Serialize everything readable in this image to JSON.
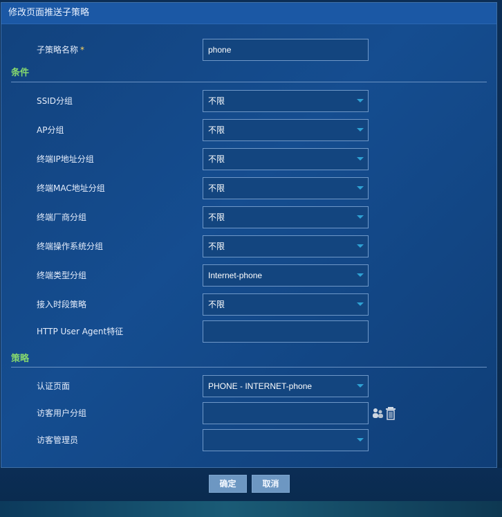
{
  "dialog": {
    "title": "修改页面推送子策略",
    "name_label": "子策略名称",
    "required_mark": "*",
    "name_value": "phone",
    "conditions_title": "条件",
    "policy_title": "策略"
  },
  "conditions": [
    {
      "label": "SSID分组",
      "value": "不限"
    },
    {
      "label": "AP分组",
      "value": "不限"
    },
    {
      "label": "终端IP地址分组",
      "value": "不限"
    },
    {
      "label": "终端MAC地址分组",
      "value": "不限"
    },
    {
      "label": "终端厂商分组",
      "value": "不限"
    },
    {
      "label": "终端操作系统分组",
      "value": "不限"
    },
    {
      "label": "终端类型分组",
      "value": "Internet-phone"
    },
    {
      "label": "接入时段策略",
      "value": "不限"
    },
    {
      "label": "HTTP User Agent特征",
      "value": ""
    }
  ],
  "policy": [
    {
      "label": "认证页面",
      "value": "PHONE - INTERNET-phone"
    },
    {
      "label": "访客用户分组",
      "value": ""
    },
    {
      "label": "访客管理员",
      "value": ""
    }
  ],
  "icons": {
    "user_group": "user-group-icon",
    "trash": "trash-icon"
  },
  "buttons": {
    "ok": "确定",
    "cancel": "取消"
  }
}
